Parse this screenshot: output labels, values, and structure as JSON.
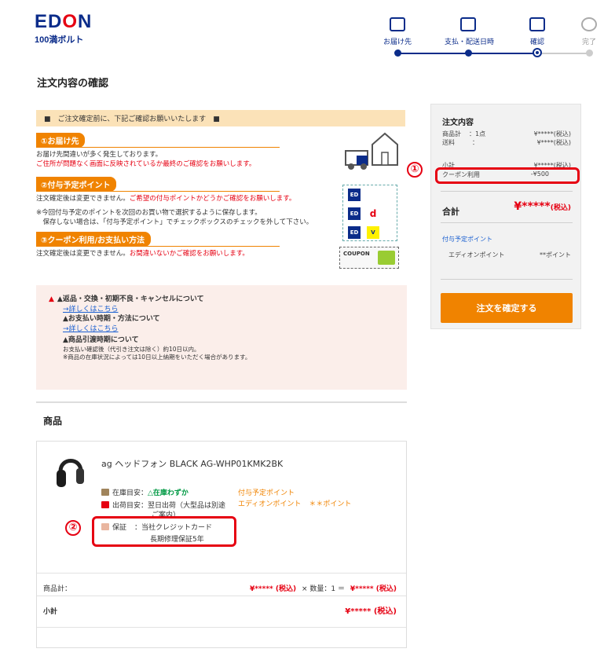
{
  "header": {
    "logo_main_pre": "ED",
    "logo_main_o": "O",
    "logo_main_post": "N",
    "logo_sub": "100満ボルト",
    "steps": [
      {
        "label": "お届け先",
        "icon": "truck-icon"
      },
      {
        "label": "支払・配送日時",
        "icon": "calendar-icon"
      },
      {
        "label": "確認",
        "icon": "list-icon"
      },
      {
        "label": "完了",
        "icon": "check-circle-icon"
      }
    ],
    "current_step": 3
  },
  "page_title": "注文内容の確認",
  "notice": {
    "head": "■　ご注文確定前に、下記ご確認お願いいたします　■",
    "sections": [
      {
        "label": "①お届け先",
        "text1": "お届け先間違いが多く発生しております。",
        "text2_red": "ご住所が問題なく画面に反映されているか最終のご確認をお願いします。"
      },
      {
        "label": "②付与予定ポイント",
        "text1": "注文確定後は変更できません。",
        "text1_red": "ご希望の付与ポイントかどうかご確認をお願いします。",
        "text2": "※今回付与予定のポイントを次回のお買い物で選択するように保存します。",
        "text3": "　保存しない場合は、「付与予定ポイント」でチェックボックスのチェックを外して下さい。"
      },
      {
        "label": "③クーポン利用/お支払い方法",
        "text1": "注文確定後は変更できません。",
        "text1_red": "お間違いないかご確認をお願いします。"
      }
    ],
    "coupon_label": "COUPON"
  },
  "warning": {
    "h1": "▲返品・交換・初期不良・キャンセルについて",
    "link1": "→詳しくはこちら",
    "h2": "▲お支払い時期・方法について",
    "link2": "→詳しくはこちら",
    "h3": "▲商品引渡時期について",
    "note1": "お支払い確認後（代引き注文は除く）約10日以内。",
    "note2": "※商品の在庫状況によっては10日以上納期をいただく場合があります。"
  },
  "goods": {
    "title": "商品",
    "product_name": "ag ヘッドフォン BLACK AG-WHP01KMK2BK",
    "stock_label": "在庫目安：",
    "stock_value": "△在庫わずか",
    "ship_label": "出荷目安：",
    "ship_value": "翌日出荷（大型品は別途",
    "ship_value2": "ご案内）",
    "points_title": "付与予定ポイント",
    "points_name": "エディオンポイント",
    "points_value": "＊＊ポイント",
    "warranty_label": "保証",
    "warranty_value1": "：当社クレジットカード",
    "warranty_value2": "長期修理保証5年",
    "subtotal_row_label": "商品計：",
    "unit_price": "¥***** (税込)",
    "qty_text": "× 数量：1 ＝",
    "line_total": "¥***** (税込)",
    "small_total_label": "小計",
    "small_total_value": "¥***** (税込)"
  },
  "summary": {
    "title": "注文内容",
    "items_label": "商品計",
    "items_count": "：1点",
    "items_value": "¥*****(税込)",
    "shipping_label": "送料",
    "shipping_colon": "：",
    "shipping_value": "¥****(税込)",
    "subtotal_label": "小計",
    "subtotal_value": "¥*****(税込)",
    "coupon_label": "クーポン利用",
    "coupon_value": "-¥500",
    "total_label": "合計",
    "total_value": "¥*****",
    "total_tax": "(税込)",
    "points_title": "付与予定ポイント",
    "points_name": "エディオンポイント",
    "points_value": "**ポイント",
    "confirm_button": "注文を確定する"
  },
  "annotations": [
    "①",
    "②"
  ],
  "colors": {
    "brand_blue": "#0b2c8a",
    "accent_orange": "#f08300",
    "alert_red": "#e60012"
  }
}
